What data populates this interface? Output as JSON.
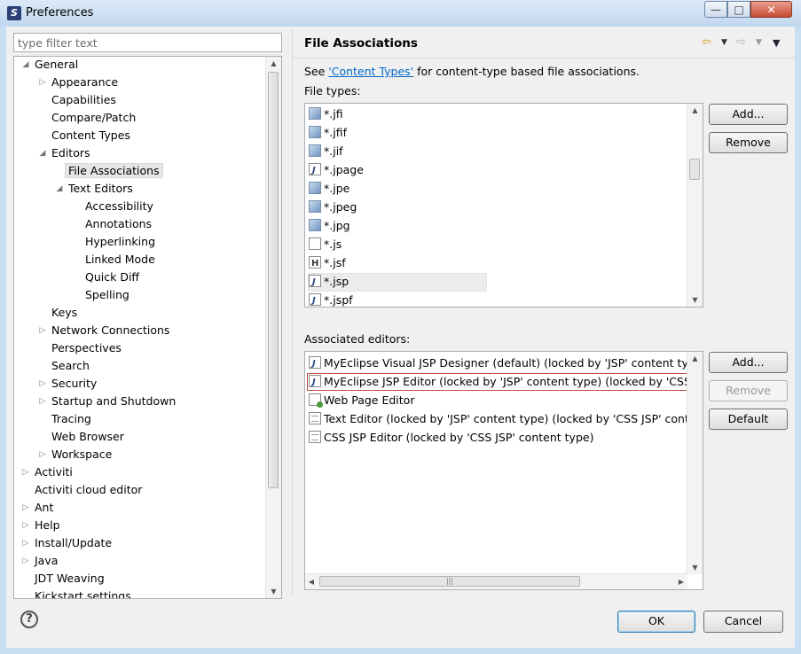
{
  "window": {
    "title": "Preferences",
    "app_icon_glyph": "S"
  },
  "filter": {
    "placeholder": "type filter text"
  },
  "tree": {
    "items": [
      {
        "label": "General",
        "expanded": true
      },
      {
        "label": "Appearance",
        "expanded": false
      },
      {
        "label": "Capabilities"
      },
      {
        "label": "Compare/Patch"
      },
      {
        "label": "Content Types"
      },
      {
        "label": "Editors",
        "expanded": true
      },
      {
        "label": "File Associations",
        "selected": true
      },
      {
        "label": "Text Editors",
        "expanded": true
      },
      {
        "label": "Accessibility"
      },
      {
        "label": "Annotations"
      },
      {
        "label": "Hyperlinking"
      },
      {
        "label": "Linked Mode"
      },
      {
        "label": "Quick Diff"
      },
      {
        "label": "Spelling"
      },
      {
        "label": "Keys"
      },
      {
        "label": "Network Connections",
        "expanded": false
      },
      {
        "label": "Perspectives"
      },
      {
        "label": "Search"
      },
      {
        "label": "Security",
        "expanded": false
      },
      {
        "label": "Startup and Shutdown",
        "expanded": false
      },
      {
        "label": "Tracing"
      },
      {
        "label": "Web Browser"
      },
      {
        "label": "Workspace",
        "expanded": false
      },
      {
        "label": "Activiti",
        "expanded": false
      },
      {
        "label": "Activiti cloud editor"
      },
      {
        "label": "Ant",
        "expanded": false
      },
      {
        "label": "Help",
        "expanded": false
      },
      {
        "label": "Install/Update",
        "expanded": false
      },
      {
        "label": "Java",
        "expanded": false
      },
      {
        "label": "JDT Weaving"
      },
      {
        "label": "Kickstart settings"
      }
    ]
  },
  "page": {
    "title": "File Associations",
    "see_prefix": "See ",
    "see_link": "'Content Types'",
    "see_suffix": " for content-type based file associations.",
    "file_types_label": "File types:",
    "associated_editors_label": "Associated editors:"
  },
  "file_types": [
    {
      "name": "*.jfi",
      "icon": "image-icon"
    },
    {
      "name": "*.jfif",
      "icon": "image-icon"
    },
    {
      "name": "*.jif",
      "icon": "image-icon"
    },
    {
      "name": "*.jpage",
      "icon": "java-page-icon"
    },
    {
      "name": "*.jpe",
      "icon": "image-icon"
    },
    {
      "name": "*.jpeg",
      "icon": "image-icon"
    },
    {
      "name": "*.jpg",
      "icon": "image-icon"
    },
    {
      "name": "*.js",
      "icon": "javascript-file-icon"
    },
    {
      "name": "*.jsf",
      "icon": "html-file-icon"
    },
    {
      "name": "*.jsp",
      "icon": "jsp-file-icon",
      "selected": true
    },
    {
      "name": "*.jspf",
      "icon": "jsp-file-icon"
    }
  ],
  "editors": [
    {
      "name": "MyEclipse Visual JSP Designer (default) (locked by 'JSP' content type) (loc",
      "icon": "jsp-designer-icon"
    },
    {
      "name": "MyEclipse JSP Editor (locked by 'JSP' content type) (locked by 'CSS JSP' c",
      "icon": "jsp-editor-icon",
      "selected": true
    },
    {
      "name": "Web Page Editor",
      "icon": "web-page-editor-icon"
    },
    {
      "name": "Text Editor (locked by 'JSP' content type) (locked by 'CSS JSP' content typ",
      "icon": "text-editor-icon"
    },
    {
      "name": "CSS JSP Editor (locked by 'CSS JSP' content type)",
      "icon": "text-editor-icon"
    }
  ],
  "buttons": {
    "ft_add": "Add...",
    "ft_remove": "Remove",
    "ed_add": "Add...",
    "ed_remove": "Remove",
    "ed_default": "Default",
    "ok": "OK",
    "cancel": "Cancel",
    "help": "?"
  },
  "nav": {
    "back": "⇦",
    "forward": "⇨",
    "menu": "▼"
  }
}
